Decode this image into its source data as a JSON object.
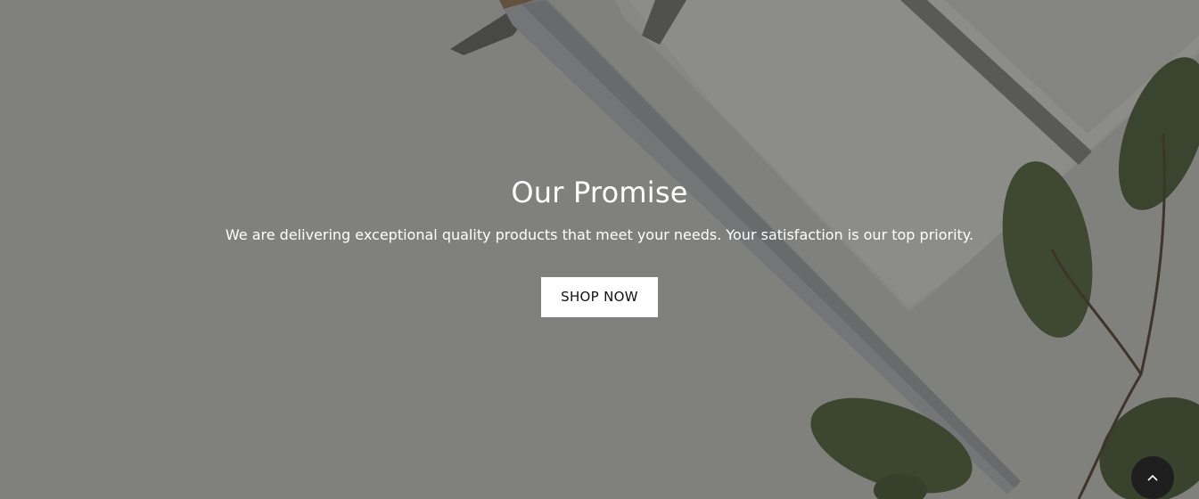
{
  "hero": {
    "title": "Our Promise",
    "text": "We are delivering exceptional quality products that meet your needs. Your satisfaction is our top priority.",
    "button_label": "SHOP NOW"
  },
  "scroll_top": {
    "icon": "chevron-up-icon"
  },
  "colors": {
    "overlay": "#00000066",
    "button_bg": "#ffffff",
    "button_text": "#111111",
    "scroll_top_bg": "#1e1e1e"
  }
}
